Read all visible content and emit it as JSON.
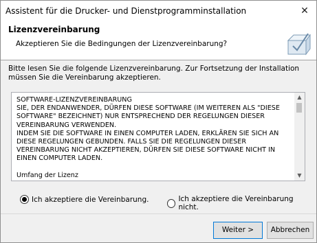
{
  "window": {
    "title": "Assistent für die Drucker- und Dienstprogramminstallation",
    "close_glyph": "✕"
  },
  "header": {
    "title": "Lizenzvereinbarung",
    "subtitle": "Akzeptieren Sie die Bedingungen der Lizenzvereinbarung?",
    "logo_icon": "setup-box-icon"
  },
  "intro": "Bitte lesen Sie die folgende Lizenzvereinbarung. Zur Fortsetzung der Installation müssen Sie die Vereinbarung akzeptieren.",
  "license": {
    "text": "SOFTWARE-LIZENZVEREINBARUNG\nSIE, DER ENDANWENDER, DÜRFEN DIESE SOFTWARE (IM WEITEREN ALS \"DIESE SOFTWARE\" BEZEICHNET) NUR ENTSPRECHEND DER REGELUNGEN DIESER VEREINBARUNG VERWENDEN.\nINDEM SIE DIE SOFTWARE IN EINEN COMPUTER LADEN, ERKLÄREN SIE SICH AN DIESE REGELUNGEN GEBUNDEN. FALLS SIE DIE REGELUNGEN DIESER VEREINBARUNG NICHT AKZEPTIEREN, DÜRFEN SIE DIESE SOFTWARE NICHT IN EINEN COMPUTER LADEN.\n\nUmfang der Lizenz"
  },
  "options": {
    "accept": "Ich akzeptiere die Vereinbarung.",
    "decline": "Ich akzeptiere die Vereinbarung nicht.",
    "selected": "accept"
  },
  "buttons": {
    "next": "Weiter >",
    "cancel": "Abbrechen"
  }
}
